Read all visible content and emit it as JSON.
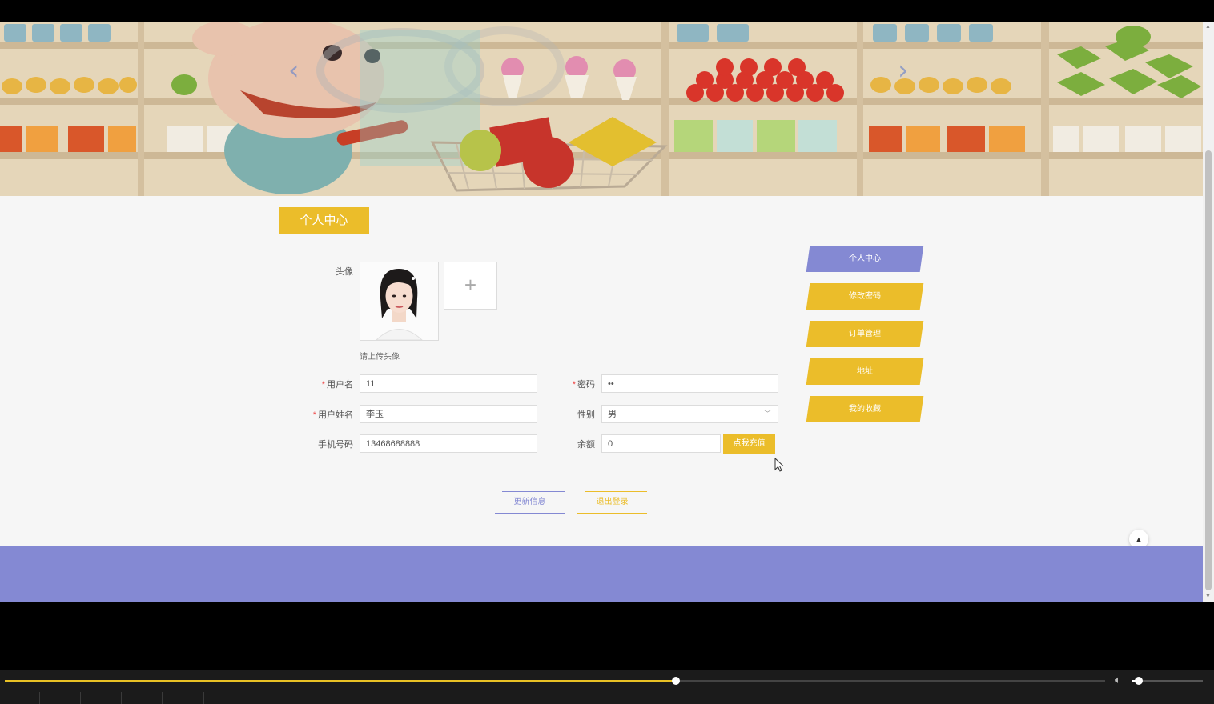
{
  "banner": {
    "prev_icon": "chevron-left-icon",
    "next_icon": "chevron-right-icon"
  },
  "section": {
    "title": "个人中心"
  },
  "avatar": {
    "label": "头像",
    "upload_icon": "plus-icon",
    "upload_symbol": "+",
    "hint": "请上传头像"
  },
  "form": {
    "username": {
      "label": "用户名",
      "required": "*",
      "value": "11"
    },
    "password": {
      "label": "密码",
      "required": "*",
      "value": "••"
    },
    "realname": {
      "label": "用户姓名",
      "required": "*",
      "value": "李玉"
    },
    "gender": {
      "label": "性别",
      "value": "男"
    },
    "phone": {
      "label": "手机号码",
      "value": "13468688888"
    },
    "balance": {
      "label": "余额",
      "value": "0",
      "charge_button": "点我充值"
    }
  },
  "sidebar": {
    "items": [
      {
        "label": "个人中心",
        "color": "#8489d3"
      },
      {
        "label": "修改密码",
        "color": "#ebbd2a"
      },
      {
        "label": "订单管理",
        "color": "#ebbd2a"
      },
      {
        "label": "地址",
        "color": "#ebbd2a"
      },
      {
        "label": "我的收藏",
        "color": "#ebbd2a"
      }
    ]
  },
  "actions": {
    "update": "更新信息",
    "logout": "退出登录"
  },
  "colors": {
    "accent_yellow": "#ebbd2a",
    "accent_purple": "#8489d3"
  },
  "player": {
    "progress": 0.61,
    "volume": 0.09,
    "volume_icon": "speaker-icon"
  },
  "totop": {
    "icon": "caret-up-icon"
  }
}
